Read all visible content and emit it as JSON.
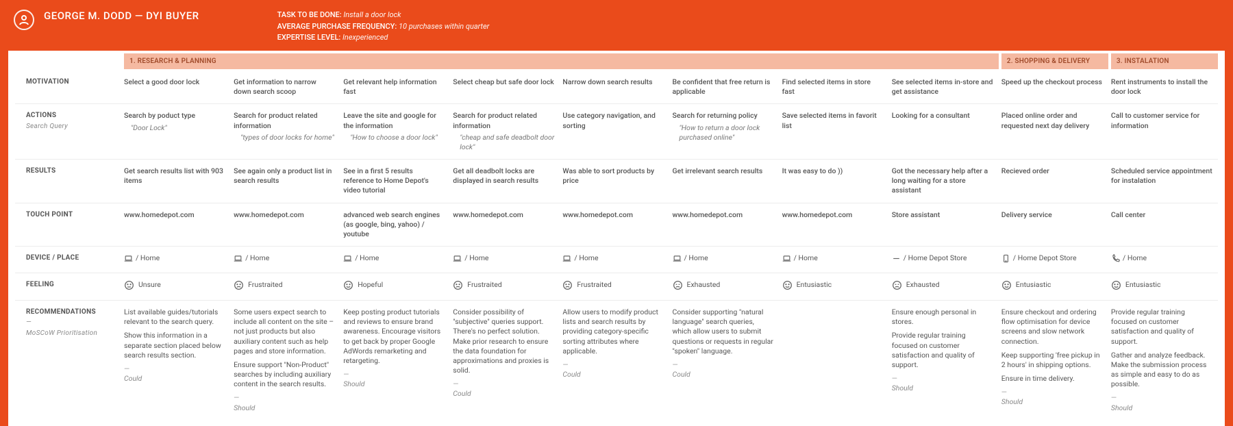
{
  "persona": {
    "name": "GEORGE M. DODD — DYI BUYER",
    "meta": [
      {
        "label": "TASK TO BE DONE:",
        "value": "Install a door lock"
      },
      {
        "label": "AVERAGE PURCHASE FREQUENCY:",
        "value": "10 purchases within quarter"
      },
      {
        "label": "EXPERTISE LEVEL:",
        "value": "Inexperienced"
      }
    ]
  },
  "phases": {
    "p1": "1. RESEARCH & PLANNING",
    "p2": "2. SHOPPING & DELIVERY",
    "p3": "3. INSTALATION"
  },
  "rowlabels": {
    "motivation": "MOTIVATION",
    "actions": "ACTIONS",
    "actions_sub": "Search Query",
    "results": "RESULTS",
    "touchpoint": "TOUCH POINT",
    "device": "DEVICE / PLACE",
    "feeling": "FEELING",
    "recommendations": "RECOMMENDATIONS",
    "recommendations_sub": "MoSCoW Prioritisation"
  },
  "feelings": {
    "unsure": "Unsure",
    "frustrated": "Frustraited",
    "hopeful": "Hopeful",
    "exhausted": "Exhausted",
    "enthusiastic": "Entusiastic"
  },
  "columns": [
    {
      "motivation": "Select a good door lock",
      "action": "Search by poduct type",
      "action_query": "\"Door Lock\"",
      "result": "Get search results list with 903 items",
      "touchpoint": "www.homedepot.com",
      "device": "laptop",
      "place": "Home",
      "feeling": "unsure",
      "rec": [
        "List available guides/tutorials relevant to the search query.",
        "Show this information in a separate section placed below search results section."
      ],
      "moscow": "Could"
    },
    {
      "motivation": "Get information to narrow down search scoop",
      "action": "Search for product related information",
      "action_query": "\"types of door locks for home\"",
      "result": "See again only a product list in search results",
      "touchpoint": "www.homedepot.com",
      "device": "laptop",
      "place": "Home",
      "feeling": "frustrated",
      "rec": [
        "Some users expect search to include all content on the site – not just products but also auxiliary content such as help pages and store information.",
        "Ensure support \"Non-Product\" searches by including auxiliary content in the search results."
      ],
      "moscow": "Should"
    },
    {
      "motivation": "Get relevant help information fast",
      "action": "Leave the site and google for the information",
      "action_query": "\"How to choose a door lock\"",
      "result": "See in a first 5 results reference to Home Depot's video tutorial",
      "touchpoint": "advanced web search engines (as google, bing, yahoo)  /  youtube",
      "device": "laptop",
      "place": "Home",
      "feeling": "hopeful",
      "rec": [
        "Keep posting product tutorials and reviews to ensure brand awareness. Encourage visitors to get back by proper Google AdWords remarketing and retargeting."
      ],
      "moscow": "Should"
    },
    {
      "motivation": "Select cheap but safe door lock",
      "action": "Search for product related information",
      "action_query": "\"cheap and safe deadbolt door lock\"",
      "result": "Get all deadbolt locks are displayed in search results",
      "touchpoint": "www.homedepot.com",
      "device": "laptop",
      "place": "Home",
      "feeling": "frustrated",
      "rec": [
        "Consider possibility of \"subjective\" queries support. There's no perfect solution. Make prior research to ensure the data foundation for approximations and proxies is solid."
      ],
      "moscow": "Could"
    },
    {
      "motivation": "Narrow down search results",
      "action": "Use category navigation, and sorting",
      "action_query": "",
      "result": "Was able to sort products by price",
      "touchpoint": "www.homedepot.com",
      "device": "laptop",
      "place": "Home",
      "feeling": "frustrated",
      "rec": [
        "Allow users to modify product lists and search results by providing category-specific sorting attributes where applicable."
      ],
      "moscow": "Could"
    },
    {
      "motivation": "Be confident that free return is applicable",
      "action": "Search for returning policy",
      "action_query": "\"How to return a door lock purchased online\"",
      "result": "Get irrelevant search results",
      "touchpoint": "www.homedepot.com",
      "device": "laptop",
      "place": "Home",
      "feeling": "exhausted",
      "rec": [
        "Consider supporting \"natural language\" search queries, which allow users to submit questions or requests in regular \"spoken\" language."
      ],
      "moscow": "Could"
    },
    {
      "motivation": "Find selected items in store fast",
      "action": "Save selected items in favorit list",
      "action_query": "",
      "result": "It was easy to do ))",
      "touchpoint": "www.homedepot.com",
      "device": "laptop",
      "place": "Home",
      "feeling": "enthusiastic",
      "rec": [],
      "moscow": ""
    },
    {
      "motivation": "See selected items in-store and get assistance",
      "action": "Looking for a consultant",
      "action_query": "",
      "result": "Got the necessary help after a long waiting for a store assistant",
      "touchpoint": "Store assistant",
      "device": "none",
      "place": "Home Depot Store",
      "feeling": "exhausted",
      "rec": [
        "Ensure enough personal in stores.",
        "Provide regular training focused on customer satisfaction and quality of support."
      ],
      "moscow": "Should"
    },
    {
      "motivation": "Speed up the checkout process",
      "action": "Placed online order and requested next day delivery",
      "action_query": "",
      "result": "Recieved order",
      "touchpoint": "Delivery service",
      "device": "phone",
      "place": "Home Depot Store",
      "feeling": "enthusiastic",
      "rec": [
        "Ensure checkout and ordering flow optimisation for device screens and slow network connection.",
        "Keep supporting 'free pickup in 2 hours' in shipping options.",
        "Ensure in time delivery."
      ],
      "moscow": "Should"
    },
    {
      "motivation": "Rent instruments to install the door lock",
      "action": "Call to customer service for information",
      "action_query": "",
      "result": "Scheduled service appointment for instalation",
      "touchpoint": "Call center",
      "device": "call",
      "place": "Home",
      "feeling": "enthusiastic",
      "rec": [
        "Provide regular training focused on customer satisfaction and quality of support.",
        "Gather and analyze feedback. Make the submission process as simple and easy to do as possible."
      ],
      "moscow": "Should"
    }
  ]
}
